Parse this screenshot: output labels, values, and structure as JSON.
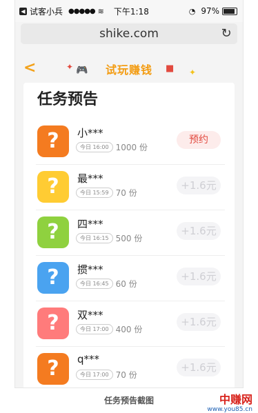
{
  "status_bar": {
    "app": "试客小兵",
    "signal": "●●●●●",
    "time": "下午1:18",
    "battery": "97%",
    "battery_level": 0.97
  },
  "browser": {
    "url": "shike.com"
  },
  "header": {
    "title": "试玩赚钱"
  },
  "section": {
    "title": "任务预告"
  },
  "tasks": [
    {
      "name": "小***",
      "time_tag": "今日 16:00",
      "qty": "1000 份",
      "action": "预约",
      "action_type": "reserve",
      "icon_color": "#f47b20"
    },
    {
      "name": "最***",
      "time_tag": "今日 15:59",
      "qty": "70 份",
      "action": "+1.6元",
      "action_type": "reward",
      "icon_color": "#ffcc33"
    },
    {
      "name": "四***",
      "time_tag": "今日 16:15",
      "qty": "500 份",
      "action": "+1.6元",
      "action_type": "reward",
      "icon_color": "#8fd13f"
    },
    {
      "name": "掼***",
      "time_tag": "今日 16:45",
      "qty": "60 份",
      "action": "+1.6元",
      "action_type": "reward",
      "icon_color": "#4aa3f0"
    },
    {
      "name": "双***",
      "time_tag": "今日 17:00",
      "qty": "400 份",
      "action": "+1.6元",
      "action_type": "reward",
      "icon_color": "#ff7b7b"
    },
    {
      "name": "q***",
      "time_tag": "今日 17:00",
      "qty": "70 份",
      "action": "+1.6元",
      "action_type": "reward",
      "icon_color": "#f47b20"
    }
  ],
  "caption": "任务预告截图",
  "watermark": {
    "name": "中赚网",
    "url": "www.you85.cn"
  }
}
